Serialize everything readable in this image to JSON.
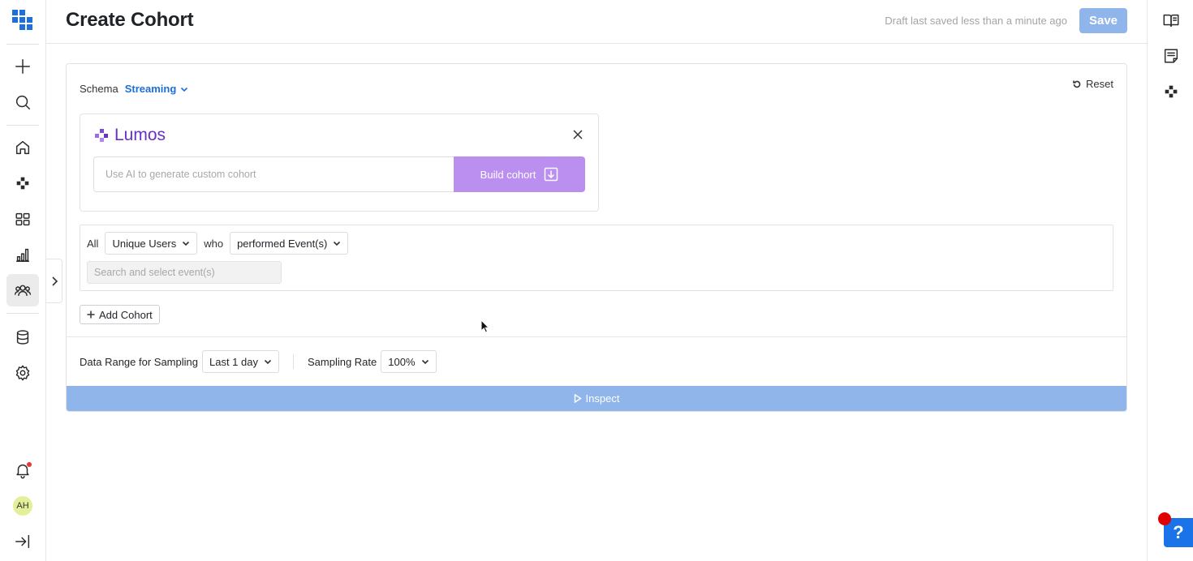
{
  "header": {
    "title": "Create Cohort",
    "draft_status": "Draft last saved less than a minute ago",
    "save_label": "Save"
  },
  "sidebar": {
    "items": [
      {
        "icon": "plus-icon"
      },
      {
        "icon": "search-icon"
      },
      {
        "icon": "home-icon"
      },
      {
        "icon": "events-icon"
      },
      {
        "icon": "dashboards-icon"
      },
      {
        "icon": "analytics-icon"
      },
      {
        "icon": "cohorts-icon",
        "active": true
      },
      {
        "icon": "database-icon"
      },
      {
        "icon": "settings-icon"
      },
      {
        "icon": "bell-icon"
      },
      {
        "icon": "collapse-sidebar-icon"
      }
    ],
    "avatar_initials": "AH"
  },
  "rightbar": {
    "items": [
      {
        "icon": "docs-book-icon"
      },
      {
        "icon": "notes-icon"
      },
      {
        "icon": "lumos-icon"
      }
    ],
    "help_label": "?"
  },
  "schema": {
    "label": "Schema",
    "value": "Streaming",
    "reset_label": "Reset"
  },
  "lumos": {
    "name": "Lumos",
    "input_placeholder": "Use AI to generate custom cohort",
    "build_label": "Build cohort"
  },
  "criteria": {
    "prefix": "All",
    "entity": "Unique Users",
    "connector": "who",
    "action": "performed Event(s)",
    "event_placeholder": "Search and select event(s)"
  },
  "add_cohort_label": "Add Cohort",
  "sampling": {
    "range_label": "Data Range for Sampling",
    "range_value": "Last 1 day",
    "rate_label": "Sampling Rate",
    "rate_value": "100%"
  },
  "inspect_label": "Inspect",
  "colors": {
    "accent": "#1e6fd9",
    "save_disabled": "#8fb5ea",
    "lumos_purple": "#6a2fc4",
    "build_button": "#bb8ff0",
    "help_blue": "#1a73e8"
  }
}
